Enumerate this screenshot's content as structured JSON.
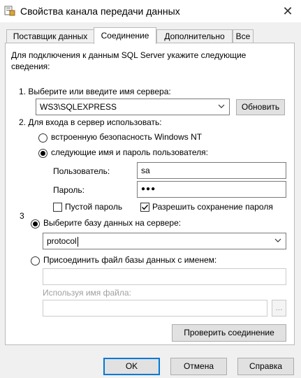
{
  "window": {
    "title": "Свойства канала передачи данных",
    "close_label": "✕"
  },
  "tabs": [
    {
      "label": "Поставщик данных",
      "active": false
    },
    {
      "label": "Соединение",
      "active": true
    },
    {
      "label": "Дополнительно",
      "active": false
    },
    {
      "label": "Все",
      "active": false
    }
  ],
  "intro_text": [
    "Для подключения к данным SQL Server укажите следующие",
    "сведения:"
  ],
  "server": {
    "step_label": "1. Выберите или введите имя сервера:",
    "value": "WS3\\SQLEXPRESS",
    "refresh_label": "Обновить"
  },
  "login": {
    "step_label": "2. Для входа в сервер использовать:",
    "option_windows": "встроенную безопасность Windows NT",
    "option_password": "следующие имя и пароль пользователя:",
    "selected": "password",
    "user_label": "Пользователь:",
    "user_value": "sa",
    "password_label": "Пароль:",
    "password_value": "●●●",
    "blank_password_label": "Пустой пароль",
    "blank_password_checked": false,
    "allow_save_label": "Разрешить сохранение пароля",
    "allow_save_checked": true
  },
  "database": {
    "step_label": "3",
    "option_select": "Выберите базу данных на сервере:",
    "select_value": "protocol",
    "option_attach": "Присоединить файл базы данных с именем:",
    "attach_value": "",
    "logical_name_label": "Используя имя файла:",
    "logical_name_value": "",
    "browse_label": "...",
    "selected": "select"
  },
  "test_button_label": "Проверить соединение",
  "footer": {
    "ok_label": "OK",
    "cancel_label": "Отмена",
    "help_label": "Справка"
  },
  "colors": {
    "accent": "#0078d7",
    "panel_bg": "#ffffff",
    "window_bg": "#f0f0f0"
  }
}
